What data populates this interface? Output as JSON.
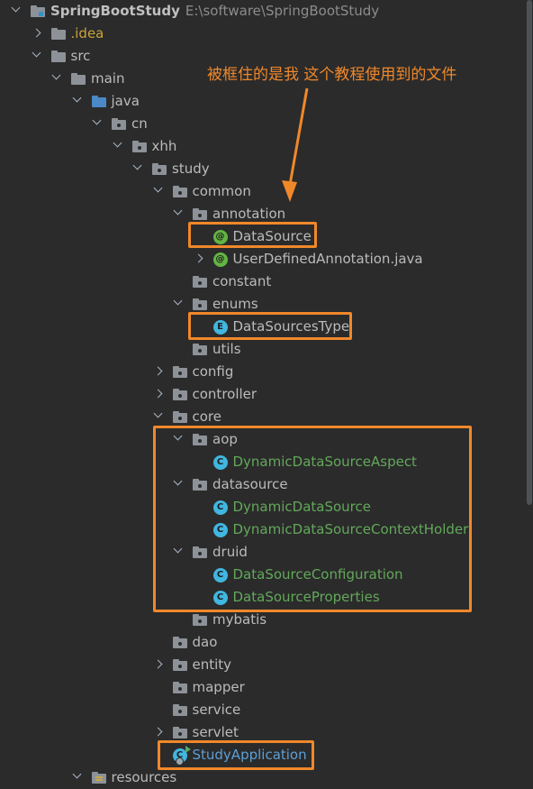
{
  "tree": [
    {
      "depth": 0,
      "chev": "open",
      "icon": "root",
      "name": "project-root",
      "label": "SpringBootStudy",
      "path": "E:\\software\\SpringBootStudy"
    },
    {
      "depth": 1,
      "chev": "closed",
      "icon": "folder",
      "name": "folder-idea",
      "label": ".idea",
      "color": "yellow"
    },
    {
      "depth": 1,
      "chev": "open",
      "icon": "folder",
      "name": "folder-src",
      "label": "src"
    },
    {
      "depth": 2,
      "chev": "open",
      "icon": "folder",
      "name": "folder-main",
      "label": "main"
    },
    {
      "depth": 3,
      "chev": "open",
      "icon": "blue",
      "name": "folder-java",
      "label": "java"
    },
    {
      "depth": 4,
      "chev": "open",
      "icon": "pkg",
      "name": "package-cn",
      "label": "cn"
    },
    {
      "depth": 5,
      "chev": "open",
      "icon": "pkg",
      "name": "package-xhh",
      "label": "xhh"
    },
    {
      "depth": 6,
      "chev": "open",
      "icon": "pkg",
      "name": "package-study",
      "label": "study"
    },
    {
      "depth": 7,
      "chev": "open",
      "icon": "pkg",
      "name": "package-common",
      "label": "common"
    },
    {
      "depth": 8,
      "chev": "open",
      "icon": "pkg",
      "name": "package-annotation",
      "label": "annotation"
    },
    {
      "depth": 9,
      "chev": "none",
      "icon": "anno",
      "name": "file-datasource",
      "label": "DataSource"
    },
    {
      "depth": 9,
      "chev": "closed",
      "icon": "anno",
      "name": "file-userdefinedannotation",
      "label": "UserDefinedAnnotation.java"
    },
    {
      "depth": 8,
      "chev": "none",
      "icon": "pkg",
      "name": "package-constant",
      "label": "constant"
    },
    {
      "depth": 8,
      "chev": "open",
      "icon": "pkg",
      "name": "package-enums",
      "label": "enums"
    },
    {
      "depth": 9,
      "chev": "none",
      "icon": "enum",
      "name": "file-datasourcestype",
      "label": "DataSourcesType"
    },
    {
      "depth": 8,
      "chev": "none",
      "icon": "pkg",
      "name": "package-utils",
      "label": "utils"
    },
    {
      "depth": 7,
      "chev": "closed",
      "icon": "pkg",
      "name": "package-config",
      "label": "config"
    },
    {
      "depth": 7,
      "chev": "closed",
      "icon": "pkg",
      "name": "package-controller",
      "label": "controller"
    },
    {
      "depth": 7,
      "chev": "open",
      "icon": "pkg",
      "name": "package-core",
      "label": "core"
    },
    {
      "depth": 8,
      "chev": "open",
      "icon": "pkg",
      "name": "package-aop",
      "label": "aop"
    },
    {
      "depth": 9,
      "chev": "none",
      "icon": "cls",
      "name": "file-dynamicdatasourceaspect",
      "label": "DynamicDataSourceAspect",
      "color": "green"
    },
    {
      "depth": 8,
      "chev": "open",
      "icon": "pkg",
      "name": "package-datasource",
      "label": "datasource"
    },
    {
      "depth": 9,
      "chev": "none",
      "icon": "cls",
      "name": "file-dynamicdatasource",
      "label": "DynamicDataSource",
      "color": "green"
    },
    {
      "depth": 9,
      "chev": "none",
      "icon": "cls",
      "name": "file-dynamicdatasourcecontextholder",
      "label": "DynamicDataSourceContextHolder",
      "color": "green"
    },
    {
      "depth": 8,
      "chev": "open",
      "icon": "pkg",
      "name": "package-druid",
      "label": "druid"
    },
    {
      "depth": 9,
      "chev": "none",
      "icon": "cls",
      "name": "file-datasourceconfiguration",
      "label": "DataSourceConfiguration",
      "color": "green"
    },
    {
      "depth": 9,
      "chev": "none",
      "icon": "cls",
      "name": "file-datasourceproperties",
      "label": "DataSourceProperties",
      "color": "green"
    },
    {
      "depth": 8,
      "chev": "none",
      "icon": "pkg",
      "name": "package-mybatis",
      "label": "mybatis"
    },
    {
      "depth": 7,
      "chev": "none",
      "icon": "pkg",
      "name": "package-dao",
      "label": "dao"
    },
    {
      "depth": 7,
      "chev": "closed",
      "icon": "pkg",
      "name": "package-entity",
      "label": "entity"
    },
    {
      "depth": 7,
      "chev": "none",
      "icon": "pkg",
      "name": "package-mapper",
      "label": "mapper"
    },
    {
      "depth": 7,
      "chev": "none",
      "icon": "pkg",
      "name": "package-service",
      "label": "service"
    },
    {
      "depth": 7,
      "chev": "closed",
      "icon": "pkg",
      "name": "package-servlet",
      "label": "servlet"
    },
    {
      "depth": 7,
      "chev": "none",
      "icon": "app",
      "name": "file-studyapplication",
      "label": "StudyApplication",
      "color": "blue"
    },
    {
      "depth": 3,
      "chev": "open",
      "icon": "res",
      "name": "folder-resources",
      "label": "resources"
    }
  ],
  "annotation": {
    "text": "被框住的是我 这个教程使用到的文件",
    "color": "#f0882a"
  }
}
